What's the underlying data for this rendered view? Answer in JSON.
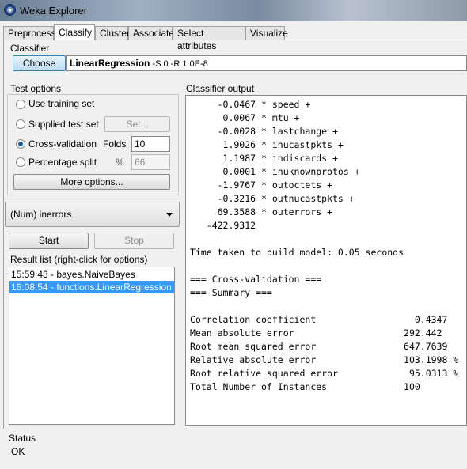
{
  "window": {
    "title": "Weka Explorer"
  },
  "tabs": [
    "Preprocess",
    "Classify",
    "Cluster",
    "Associate",
    "Select attributes",
    "Visualize"
  ],
  "active_tab": "Classify",
  "classifier": {
    "section_label": "Classifier",
    "choose_label": "Choose",
    "name": "LinearRegression",
    "options": " -S 0 -R 1.0E-8"
  },
  "test_options": {
    "section_label": "Test options",
    "use_training": "Use training set",
    "supplied_test": "Supplied test set",
    "set_button": "Set...",
    "cross_validation": "Cross-validation",
    "folds_label": "Folds",
    "folds_value": "10",
    "percentage_split": "Percentage split",
    "percent_symbol": "%",
    "percent_value": "66",
    "selected": "Cross-validation",
    "more_options": "More options..."
  },
  "target_attribute": "(Num) inerrors",
  "run": {
    "start_label": "Start",
    "stop_label": "Stop"
  },
  "result_list": {
    "label": "Result list (right-click for options)",
    "items": [
      {
        "text": "15:59:43 - bayes.NaiveBayes",
        "selected": false
      },
      {
        "text": "16:08:54 - functions.LinearRegression",
        "selected": true
      }
    ]
  },
  "output": {
    "label": "Classifier output",
    "lines": [
      "     -0.0467 * speed +",
      "      0.0067 * mtu +",
      "     -0.0028 * lastchange +",
      "      1.9026 * inucastpkts +",
      "      1.1987 * indiscards +",
      "      0.0001 * inuknownprotos +",
      "     -1.9767 * outoctets +",
      "     -0.3216 * outnucastpkts +",
      "     69.3588 * outerrors +",
      "   -422.9312",
      "",
      "Time taken to build model: 0.05 seconds",
      "",
      "=== Cross-validation ===",
      "=== Summary ===",
      "",
      "Correlation coefficient                  0.4347",
      "Mean absolute error                    292.442",
      "Root mean squared error                647.7639",
      "Relative absolute error                103.1998 %",
      "Root relative squared error             95.0313 %",
      "Total Number of Instances              100"
    ]
  },
  "status": {
    "label": "Status",
    "text": "OK"
  }
}
